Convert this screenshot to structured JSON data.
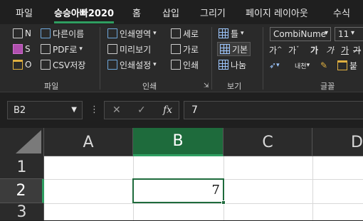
{
  "tabs": [
    "파일",
    "승승아빠2020",
    "홈",
    "삽입",
    "그리기",
    "페이지 레이아웃",
    "수식"
  ],
  "ribbon": {
    "file_group": {
      "new": "N",
      "save": "S",
      "open": "O",
      "save_as": "다른이름",
      "pdf": "PDF로",
      "csv": "CSV저장",
      "label": "파일"
    },
    "print_group": {
      "print_area": "인쇄영역",
      "preview": "미리보기",
      "print_settings": "인쇄설정",
      "portrait": "세로",
      "landscape": "가로",
      "print": "인쇄",
      "label": "인쇄"
    },
    "view_group": {
      "frame": "틀",
      "normal": "기본",
      "split": "나눔",
      "label": "보기"
    },
    "font_group": {
      "font_name": "CombiNume",
      "font_size": "11",
      "row2": [
        "가",
        "가",
        "가",
        "가",
        "가",
        "가"
      ],
      "label": "글꼴"
    }
  },
  "formula_bar": {
    "name_box": "B2",
    "cancel": "✕",
    "enter": "✓",
    "fx": "fx",
    "content": "7"
  },
  "grid": {
    "columns": [
      "A",
      "B",
      "C",
      "D"
    ],
    "rows": [
      "1",
      "2",
      "3"
    ],
    "selected_column": "B",
    "selected_row": "2",
    "active_cell_value": "7"
  }
}
